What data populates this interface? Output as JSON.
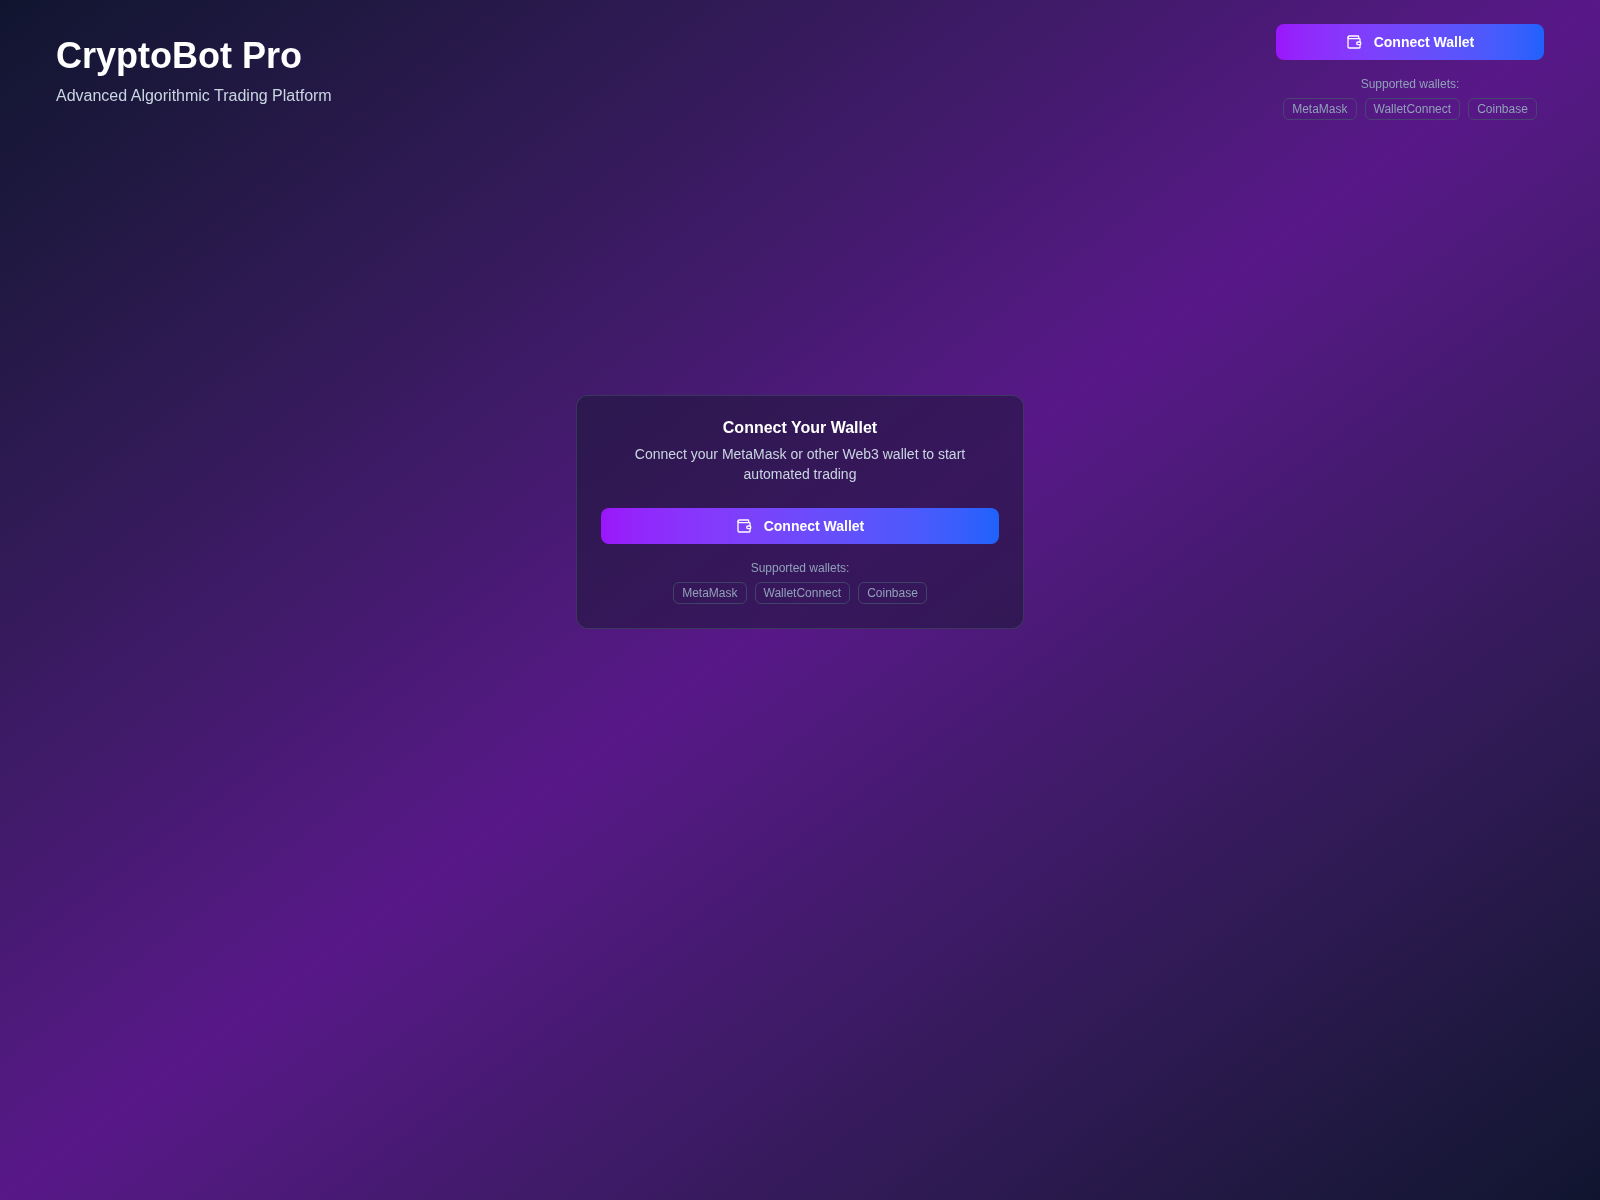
{
  "header": {
    "title": "CryptoBot Pro",
    "subtitle": "Advanced Algorithmic Trading Platform"
  },
  "header_wallet": {
    "button": "Connect Wallet",
    "supported_label": "Supported wallets:",
    "wallets": [
      "MetaMask",
      "WalletConnect",
      "Coinbase"
    ]
  },
  "card": {
    "title": "Connect Your Wallet",
    "description": "Connect your MetaMask or other Web3 wallet to start automated trading",
    "button": "Connect Wallet",
    "supported_label": "Supported wallets:",
    "wallets": [
      "MetaMask",
      "WalletConnect",
      "Coinbase"
    ]
  }
}
